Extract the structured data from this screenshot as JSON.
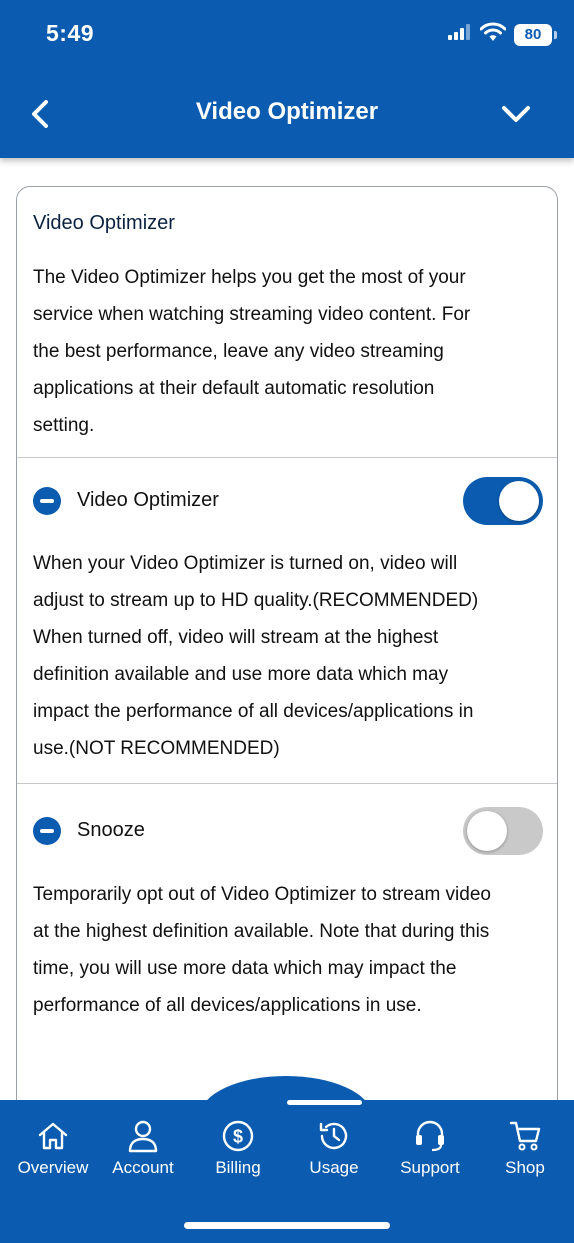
{
  "status_bar": {
    "time": "5:49",
    "battery": "80"
  },
  "header": {
    "title": "Video Optimizer"
  },
  "card": {
    "title": "Video Optimizer",
    "description_lines": [
      "The Video Optimizer helps you get the most of your",
      "service when watching streaming video content. For",
      "the best performance, leave any video streaming",
      "applications at their default automatic resolution",
      "setting."
    ],
    "sections": [
      {
        "label": "Video Optimizer",
        "toggle_on": true,
        "lines": [
          "When your Video Optimizer is turned on, video will",
          "adjust to stream up to HD quality.(RECOMMENDED)",
          "When turned off, video will stream at the highest",
          "definition available and use more data which may",
          "impact the performance of all devices/applications in",
          "use.(NOT RECOMMENDED)"
        ]
      },
      {
        "label": "Snooze",
        "toggle_on": false,
        "lines": [
          "Temporarily opt out of Video Optimizer to stream video",
          "at the highest definition available. Note that during this",
          "time, you will use more data which may impact the",
          "performance of all devices/applications in use."
        ]
      }
    ]
  },
  "tabbar": {
    "tabs": [
      {
        "label": "Overview",
        "icon": "home-icon"
      },
      {
        "label": "Account",
        "icon": "person-icon"
      },
      {
        "label": "Billing",
        "icon": "dollar-icon"
      },
      {
        "label": "Usage",
        "icon": "history-icon"
      },
      {
        "label": "Support",
        "icon": "headset-icon"
      },
      {
        "label": "Shop",
        "icon": "cart-icon"
      }
    ]
  },
  "colors": {
    "brand": "#0b5cb0",
    "toggle_off": "#c9c9c9"
  }
}
